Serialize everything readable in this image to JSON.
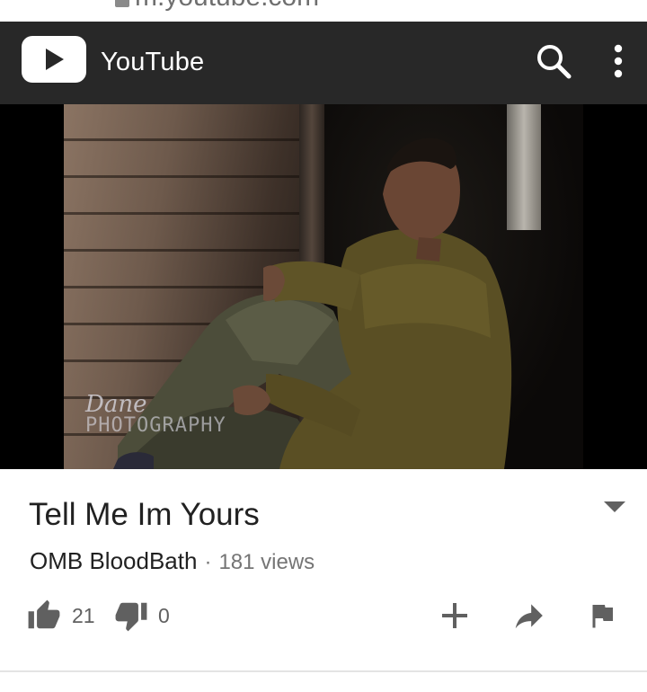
{
  "browser": {
    "url_fragment": "m.youtube.com"
  },
  "header": {
    "app_title": "YouTube",
    "logo_icon": "youtube-play-icon",
    "search_icon": "search-icon",
    "menu_icon": "more-vert-icon"
  },
  "player": {
    "watermark_line1": "Dane",
    "watermark_line2": "PHOTOGRAPHY"
  },
  "video": {
    "title": "Tell Me Im Yours",
    "channel": "OMB BloodBath",
    "separator": "·",
    "views": "181 views",
    "likes": "21",
    "dislikes": "0"
  },
  "actions": [
    "like-icon",
    "dislike-icon",
    "add-icon",
    "share-icon",
    "flag-icon"
  ],
  "colors": {
    "appbar": "#282828",
    "text_primary": "#212121",
    "text_secondary": "#757575",
    "icon": "#606060"
  }
}
